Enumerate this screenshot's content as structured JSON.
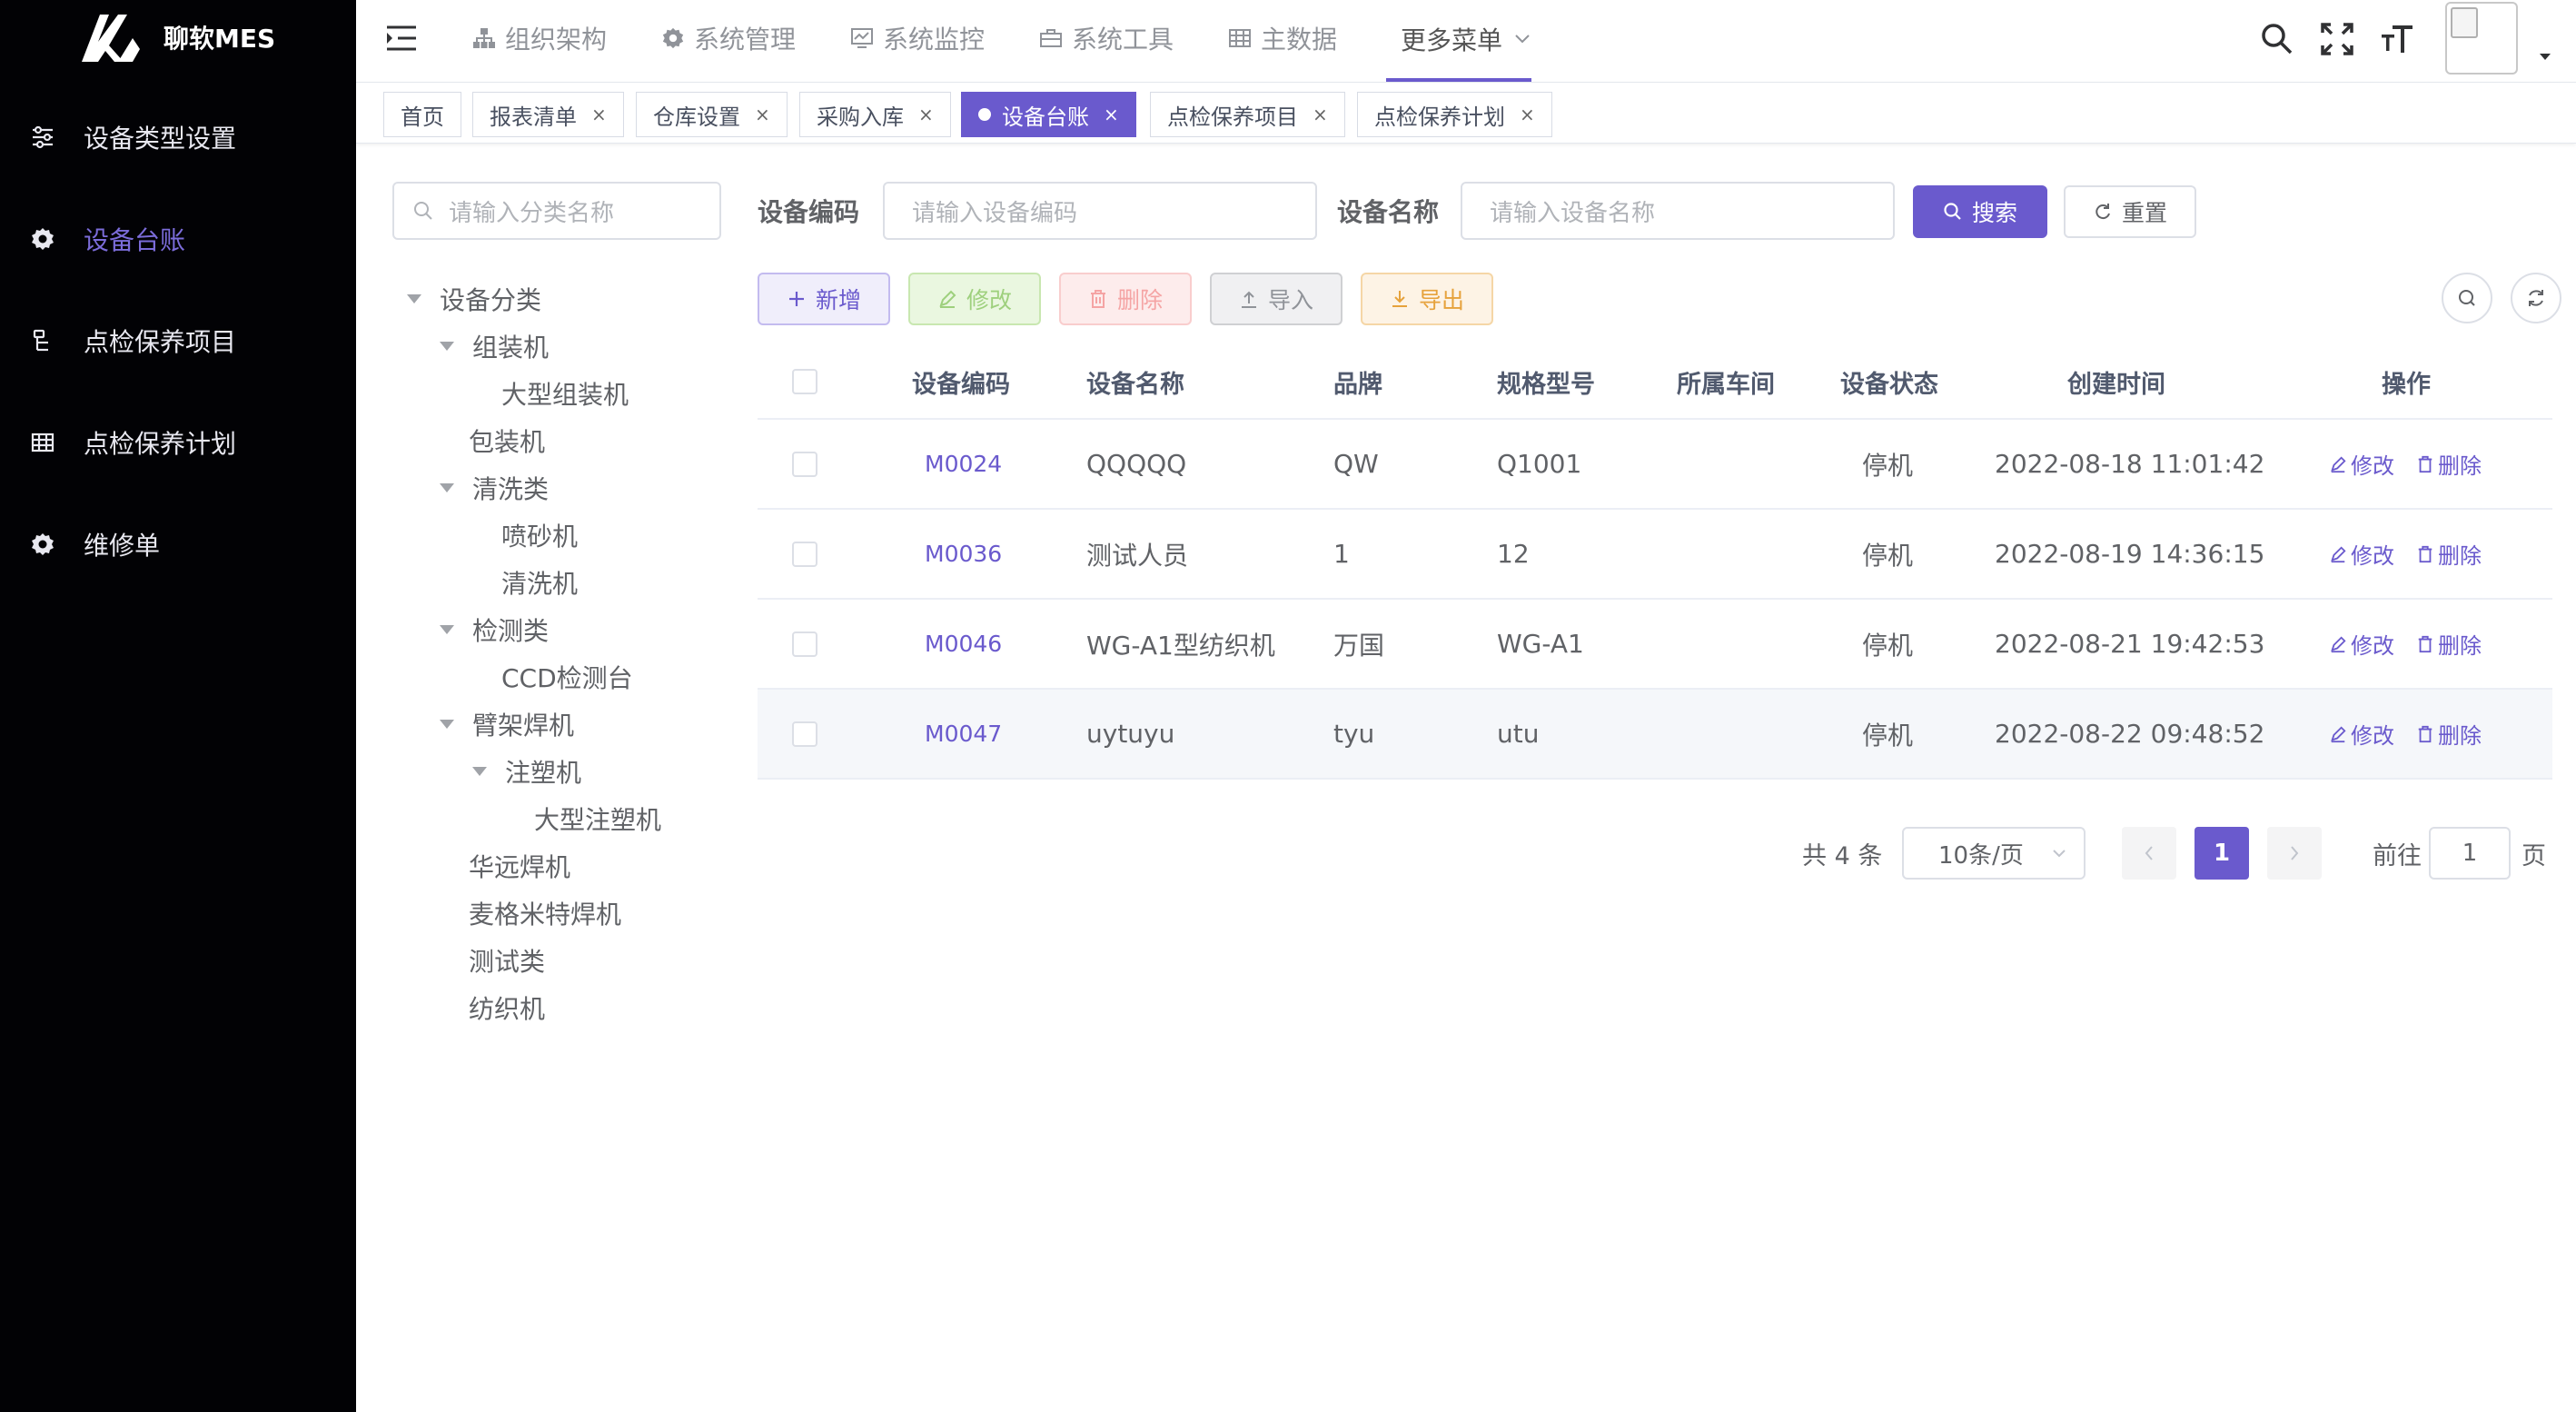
{
  "app": {
    "title": "聊软MES"
  },
  "sidebar": {
    "items": [
      {
        "label": "设备类型设置",
        "icon": "sliders-icon",
        "active": false
      },
      {
        "label": "设备台账",
        "icon": "gear-icon",
        "active": true
      },
      {
        "label": "点检保养项目",
        "icon": "list-icon",
        "active": false
      },
      {
        "label": "点检保养计划",
        "icon": "table-icon",
        "active": false
      },
      {
        "label": "维修单",
        "icon": "gear-icon",
        "active": false
      }
    ]
  },
  "topnav": {
    "items": [
      {
        "label": "组织架构",
        "icon": "org-icon"
      },
      {
        "label": "系统管理",
        "icon": "gear-icon"
      },
      {
        "label": "系统监控",
        "icon": "monitor-icon"
      },
      {
        "label": "系统工具",
        "icon": "toolbox-icon"
      },
      {
        "label": "主数据",
        "icon": "grid-icon"
      },
      {
        "label": "更多菜单",
        "icon": "chevron-down-icon",
        "active": true
      }
    ]
  },
  "tags": [
    {
      "label": "首页",
      "closable": false,
      "active": false
    },
    {
      "label": "报表清单",
      "closable": true,
      "active": false
    },
    {
      "label": "仓库设置",
      "closable": true,
      "active": false
    },
    {
      "label": "采购入库",
      "closable": true,
      "active": false
    },
    {
      "label": "设备台账",
      "closable": true,
      "active": true
    },
    {
      "label": "点检保养项目",
      "closable": true,
      "active": false
    },
    {
      "label": "点检保养计划",
      "closable": true,
      "active": false
    }
  ],
  "tree": {
    "search_placeholder": "请输入分类名称",
    "nodes": [
      {
        "label": "设备分类",
        "level": 0,
        "expanded": true
      },
      {
        "label": "组装机",
        "level": 1,
        "expanded": true
      },
      {
        "label": "大型组装机",
        "level": 2
      },
      {
        "label": "包装机",
        "level": 1
      },
      {
        "label": "清洗类",
        "level": 1,
        "expanded": true
      },
      {
        "label": "喷砂机",
        "level": 2
      },
      {
        "label": "清洗机",
        "level": 2
      },
      {
        "label": "检测类",
        "level": 1,
        "expanded": true
      },
      {
        "label": "CCD检测台",
        "level": 2
      },
      {
        "label": "臂架焊机",
        "level": 1,
        "expanded": true
      },
      {
        "label": "注塑机",
        "level": 2,
        "expanded": true
      },
      {
        "label": "大型注塑机",
        "level": 3
      },
      {
        "label": "华远焊机",
        "level": 1
      },
      {
        "label": "麦格米特焊机",
        "level": 1
      },
      {
        "label": "测试类",
        "level": 1
      },
      {
        "label": "纺织机",
        "level": 1
      }
    ]
  },
  "filter": {
    "code_label": "设备编码",
    "code_placeholder": "请输入设备编码",
    "name_label": "设备名称",
    "name_placeholder": "请输入设备名称",
    "search_label": "搜索",
    "reset_label": "重置"
  },
  "toolbar": {
    "add_label": "新增",
    "edit_label": "修改",
    "delete_label": "删除",
    "import_label": "导入",
    "export_label": "导出"
  },
  "table": {
    "columns": [
      "设备编码",
      "设备名称",
      "品牌",
      "规格型号",
      "所属车间",
      "设备状态",
      "创建时间",
      "操作"
    ],
    "rows": [
      {
        "code": "M0024",
        "name": "QQQQQ",
        "brand": "QW",
        "spec": "Q1001",
        "workshop": "",
        "status": "停机",
        "created": "2022-08-18 11:01:42"
      },
      {
        "code": "M0036",
        "name": "测试人员",
        "brand": "1",
        "spec": "12",
        "workshop": "",
        "status": "停机",
        "created": "2022-08-19 14:36:15"
      },
      {
        "code": "M0046",
        "name": "WG-A1型纺织机",
        "brand": "万国",
        "spec": "WG-A1",
        "workshop": "",
        "status": "停机",
        "created": "2022-08-21 19:42:53"
      },
      {
        "code": "M0047",
        "name": "uytuyu",
        "brand": "tyu",
        "spec": "utu",
        "workshop": "",
        "status": "停机",
        "created": "2022-08-22 09:48:52"
      }
    ],
    "row_edit_label": "修改",
    "row_delete_label": "删除"
  },
  "pagination": {
    "total_text": "共 4 条",
    "page_size": "10条/页",
    "current_page": "1",
    "goto_prefix": "前往",
    "goto_value": "1",
    "goto_suffix": "页"
  },
  "colors": {
    "primary": "#6a5acd",
    "sidebar_bg": "#020205",
    "sidebar_active": "#7b6cd9"
  }
}
